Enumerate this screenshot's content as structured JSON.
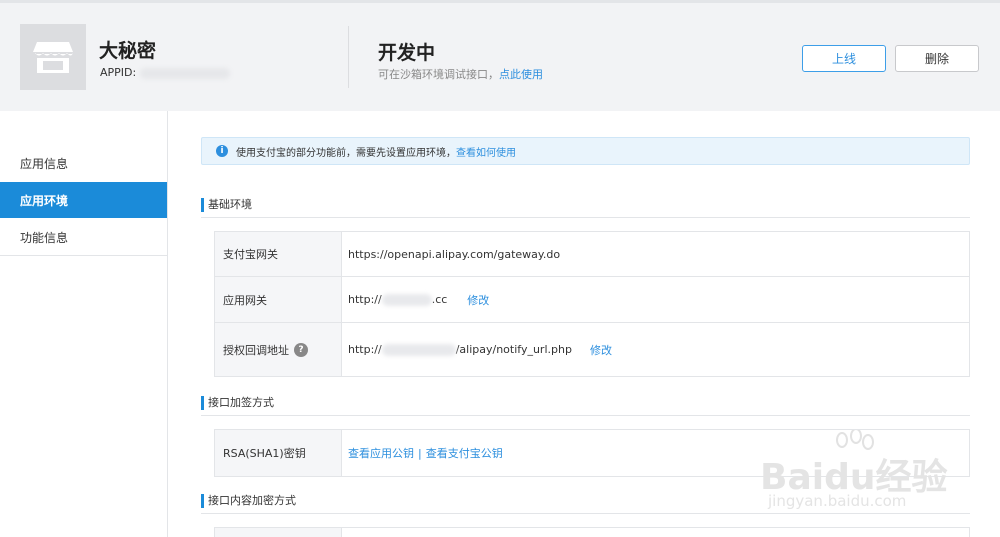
{
  "header": {
    "app_name": "大秘密",
    "appid_label": "APPID:",
    "status_title": "开发中",
    "status_sub": "可在沙箱环境调试接口，",
    "status_link": "点此使用",
    "btn_online": "上线",
    "btn_delete": "删除"
  },
  "sidebar": {
    "items": [
      {
        "label": "应用信息"
      },
      {
        "label": "应用环境"
      },
      {
        "label": "功能信息"
      }
    ]
  },
  "notice": {
    "text": "使用支付宝的部分功能前，需要先设置应用环境，",
    "link": "查看如何使用"
  },
  "sections": {
    "basic": "基础环境",
    "sign": "接口加签方式",
    "encrypt": "接口内容加密方式"
  },
  "basic_rows": {
    "gateway_label": "支付宝网关",
    "gateway_value": "https://openapi.alipay.com/gateway.do",
    "app_gateway_label": "应用网关",
    "app_gateway_prefix": "http://",
    "app_gateway_suffix": ".cc",
    "callback_label": "授权回调地址",
    "callback_prefix": "http://",
    "callback_suffix": "/alipay/notify_url.php",
    "edit": "修改"
  },
  "sign_rows": {
    "rsa_label": "RSA(SHA1)密钥",
    "view_app_key": "查看应用公钥",
    "separator": "|",
    "view_alipay_key": "查看支付宝公钥"
  },
  "watermark": {
    "main": "Baidu经验",
    "sub": "jingyan.baidu.com"
  }
}
